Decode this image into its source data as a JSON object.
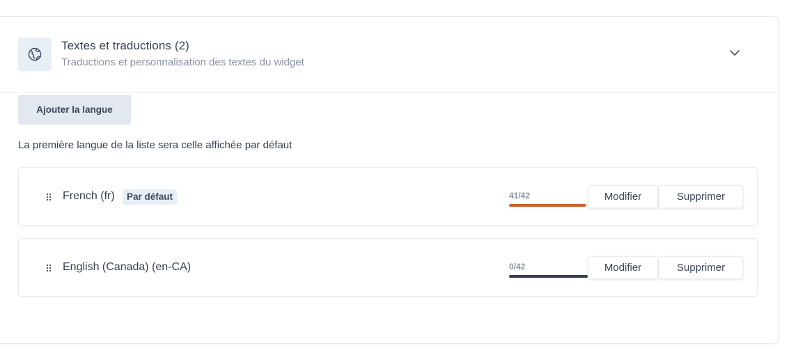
{
  "section": {
    "title": "Textes et traductions (2)",
    "subtitle": "Traductions et personnalisation des textes du widget",
    "icon": "globe-icon",
    "toggle_icon": "chevron-down-icon"
  },
  "actions": {
    "add_language_label": "Ajouter la langue"
  },
  "hint": "La première langue de la liste sera celle affichée par défaut",
  "languages": [
    {
      "name": "French (fr)",
      "badge": "Par défaut",
      "progress_text": "41/42",
      "progress_fraction": 0.976,
      "progress_color": "#c9622e",
      "edit_label": "Modifier",
      "delete_label": "Supprimer"
    },
    {
      "name": "English (Canada) (en-CA)",
      "badge": "",
      "progress_text": "0/42",
      "progress_fraction": 0,
      "progress_color": "#374151",
      "edit_label": "Modifier",
      "delete_label": "Supprimer"
    }
  ],
  "colors": {
    "accent_bg": "#e8eef6",
    "text_primary": "#374151",
    "text_muted": "#8a93a3"
  }
}
